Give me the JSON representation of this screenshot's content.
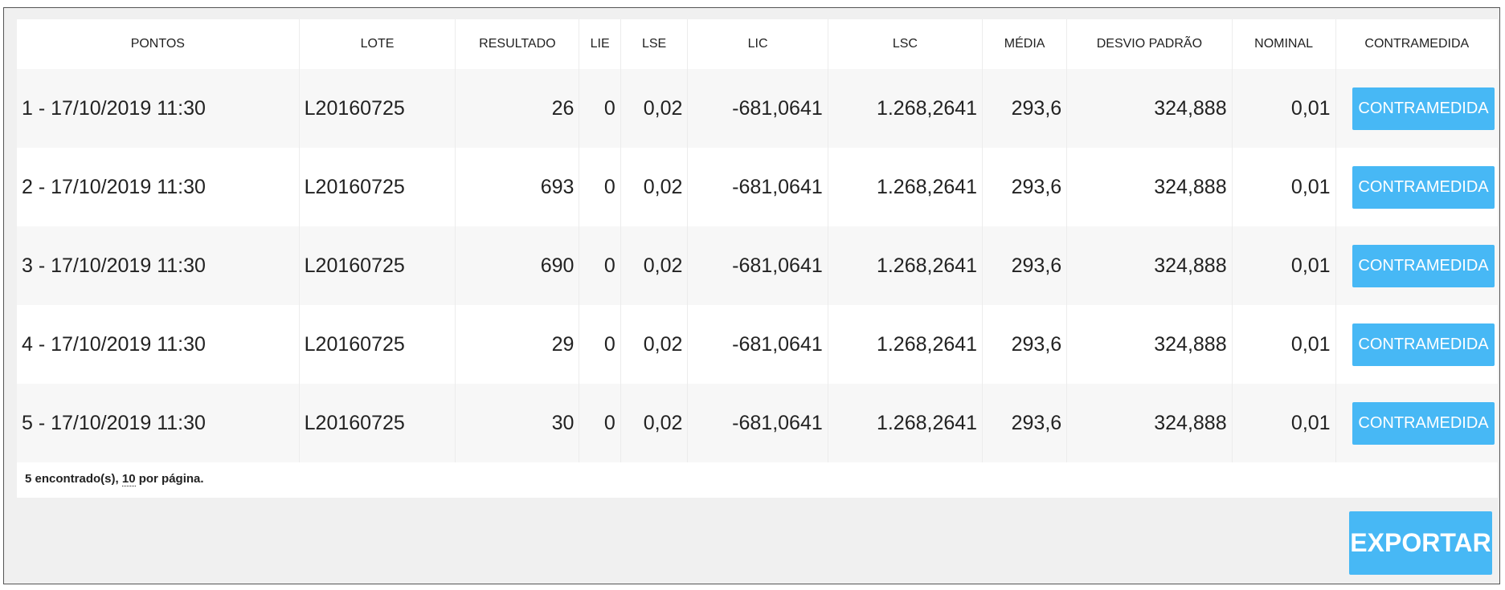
{
  "table": {
    "headers": [
      "PONTOS",
      "LOTE",
      "RESULTADO",
      "LIE",
      "LSE",
      "LIC",
      "LSC",
      "MÉDIA",
      "DESVIO PADRÃO",
      "NOMINAL",
      "CONTRAMEDIDA"
    ],
    "rows": [
      {
        "pontos": "1 - 17/10/2019 11:30",
        "lote": "L20160725",
        "resultado": "26",
        "lie": "0",
        "lse": "0,02",
        "lic": "-681,0641",
        "lsc": "1.268,2641",
        "media": "293,6",
        "desvio": "324,888",
        "nominal": "0,01",
        "acao": "CONTRAMEDIDA"
      },
      {
        "pontos": "2 - 17/10/2019 11:30",
        "lote": "L20160725",
        "resultado": "693",
        "lie": "0",
        "lse": "0,02",
        "lic": "-681,0641",
        "lsc": "1.268,2641",
        "media": "293,6",
        "desvio": "324,888",
        "nominal": "0,01",
        "acao": "CONTRAMEDIDA"
      },
      {
        "pontos": "3 - 17/10/2019 11:30",
        "lote": "L20160725",
        "resultado": "690",
        "lie": "0",
        "lse": "0,02",
        "lic": "-681,0641",
        "lsc": "1.268,2641",
        "media": "293,6",
        "desvio": "324,888",
        "nominal": "0,01",
        "acao": "CONTRAMEDIDA"
      },
      {
        "pontos": "4 - 17/10/2019 11:30",
        "lote": "L20160725",
        "resultado": "29",
        "lie": "0",
        "lse": "0,02",
        "lic": "-681,0641",
        "lsc": "1.268,2641",
        "media": "293,6",
        "desvio": "324,888",
        "nominal": "0,01",
        "acao": "CONTRAMEDIDA"
      },
      {
        "pontos": "5 - 17/10/2019 11:30",
        "lote": "L20160725",
        "resultado": "30",
        "lie": "0",
        "lse": "0,02",
        "lic": "-681,0641",
        "lsc": "1.268,2641",
        "media": "293,6",
        "desvio": "324,888",
        "nominal": "0,01",
        "acao": "CONTRAMEDIDA"
      }
    ]
  },
  "footer": {
    "found_text": "5 encontrado(s),",
    "per_page": "10",
    "per_page_suffix": "por página."
  },
  "export_label": "EXPORTAR",
  "colors": {
    "accent": "#47b8f5"
  }
}
